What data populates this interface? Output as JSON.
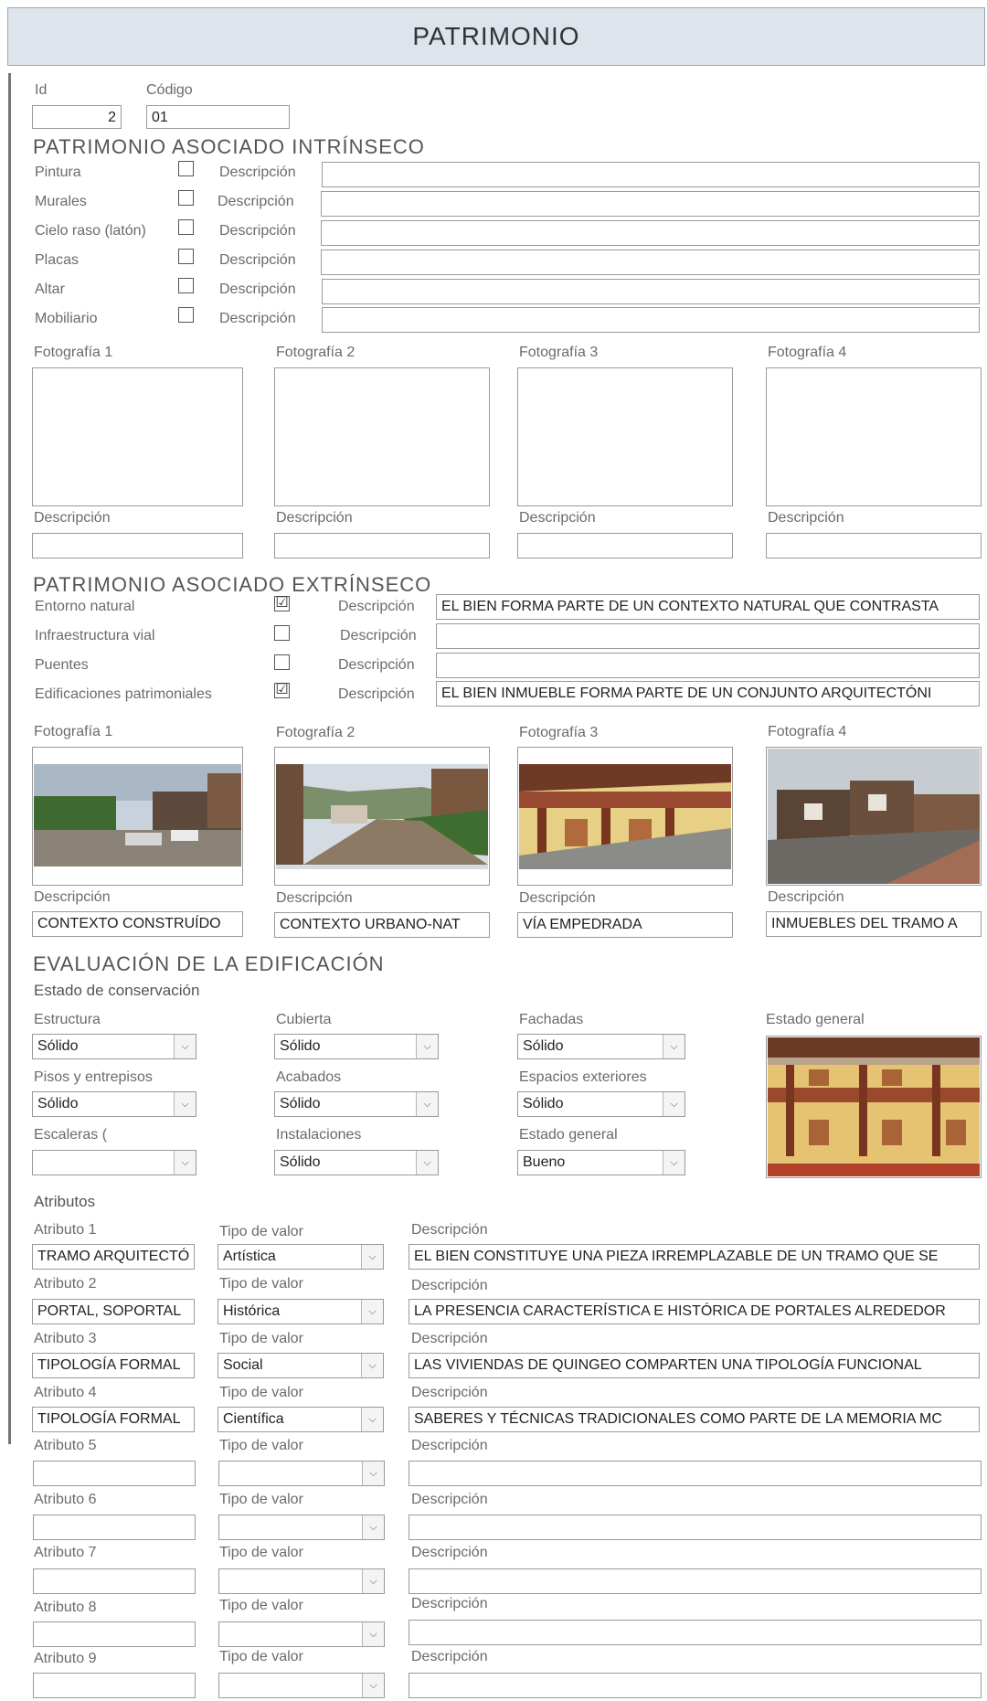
{
  "title": "PATRIMONIO",
  "id_label": "Id",
  "id_value": "2",
  "codigo_label": "Código",
  "codigo_value": "01",
  "intrinseco": {
    "heading": "PATRIMONIO ASOCIADO INTRÍNSECO",
    "desc_label": "Descripción",
    "items": [
      {
        "label": "Pintura",
        "checked": false,
        "desc": ""
      },
      {
        "label": "Murales",
        "checked": false,
        "desc": ""
      },
      {
        "label": "Cielo raso (latón)",
        "checked": false,
        "desc": ""
      },
      {
        "label": "Placas",
        "checked": false,
        "desc": ""
      },
      {
        "label": "Altar",
        "checked": false,
        "desc": ""
      },
      {
        "label": "Mobiliario",
        "checked": false,
        "desc": ""
      }
    ],
    "photos": [
      "Fotografía 1",
      "Fotografía 2",
      "Fotografía 3",
      "Fotografía 4"
    ],
    "photo_desc_label": "Descripción"
  },
  "extrinseco": {
    "heading": "PATRIMONIO ASOCIADO EXTRÍNSECO",
    "desc_label": "Descripción",
    "items": [
      {
        "label": "Entorno natural",
        "checked": true,
        "desc": "EL BIEN FORMA PARTE DE UN CONTEXTO NATURAL QUE CONTRASTA"
      },
      {
        "label": "Infraestructura vial",
        "checked": false,
        "desc": ""
      },
      {
        "label": "Puentes",
        "checked": false,
        "desc": ""
      },
      {
        "label": "Edificaciones patrimoniales",
        "checked": true,
        "desc": "EL BIEN INMUEBLE FORMA PARTE DE UN CONJUNTO ARQUITECTÓNI"
      }
    ],
    "photos": [
      "Fotografía 1",
      "Fotografía 2",
      "Fotografía 3",
      "Fotografía 4"
    ],
    "photo_desc_label": "Descripción",
    "photo_descs": [
      "CONTEXTO CONSTRUÍDO",
      "CONTEXTO URBANO-NAT",
      "VÍA EMPEDRADA",
      "INMUEBLES DEL TRAMO A"
    ]
  },
  "evaluacion": {
    "heading": "EVALUACIÓN DE LA EDIFICACIÓN",
    "subheading": "Estado de conservación",
    "fields": [
      {
        "label": "Estructura",
        "value": "Sólido"
      },
      {
        "label": "Cubierta",
        "value": "Sólido"
      },
      {
        "label": "Fachadas",
        "value": "Sólido"
      },
      {
        "label": "Pisos y entrepisos",
        "value": "Sólido"
      },
      {
        "label": "Acabados",
        "value": "Sólido"
      },
      {
        "label": "Espacios exteriores",
        "value": "Sólido"
      },
      {
        "label": "Escaleras (",
        "value": ""
      },
      {
        "label": "Instalaciones",
        "value": "Sólido"
      },
      {
        "label": "Estado general",
        "value": "Bueno"
      }
    ],
    "photo_label": "Estado general"
  },
  "atributos": {
    "heading": "Atributos",
    "tipo_label": "Tipo de valor",
    "desc_label": "Descripción",
    "rows": [
      {
        "label": "Atributo 1",
        "value": "TRAMO ARQUITECTÓ",
        "tipo": "Artística",
        "desc": "EL BIEN CONSTITUYE UNA PIEZA IRREMPLAZABLE DE UN TRAMO QUE SE"
      },
      {
        "label": "Atributo 2",
        "value": "PORTAL, SOPORTAL",
        "tipo": "Histórica",
        "desc": "LA PRESENCIA CARACTERÍSTICA E HISTÓRICA DE PORTALES ALREDEDOR"
      },
      {
        "label": "Atributo 3",
        "value": "TIPOLOGÍA FORMAL",
        "tipo": "Social",
        "desc": "LAS VIVIENDAS DE QUINGEO COMPARTEN UNA TIPOLOGÍA FUNCIONAL"
      },
      {
        "label": "Atributo 4",
        "value": "TIPOLOGÍA FORMAL",
        "tipo": "Científica",
        "desc": "SABERES Y TÉCNICAS TRADICIONALES COMO PARTE DE LA MEMORIA MC"
      },
      {
        "label": "Atributo 5",
        "value": "",
        "tipo": "",
        "desc": ""
      },
      {
        "label": "Atributo 6",
        "value": "",
        "tipo": "",
        "desc": ""
      },
      {
        "label": "Atributo 7",
        "value": "",
        "tipo": "",
        "desc": ""
      },
      {
        "label": "Atributo 8",
        "value": "",
        "tipo": "",
        "desc": ""
      },
      {
        "label": "Atributo 9",
        "value": "",
        "tipo": "",
        "desc": ""
      }
    ]
  },
  "dropdown_icon": "chevron-down-icon",
  "checkmark_glyph": "☑"
}
